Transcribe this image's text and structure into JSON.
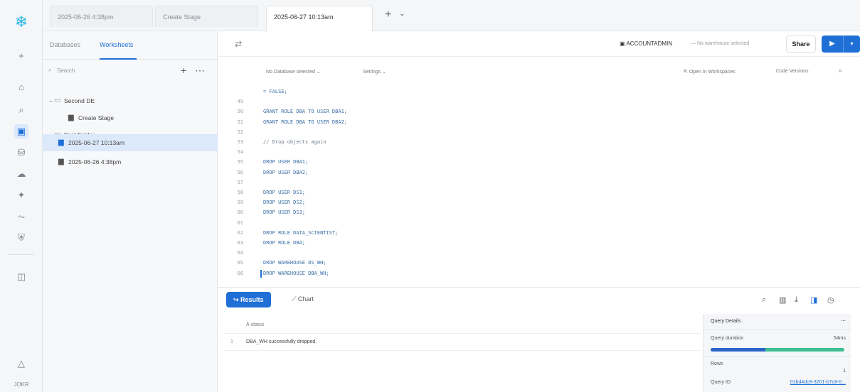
{
  "tabs": [
    "2025-06-26 4:38pm",
    "Create Stage",
    "2025-06-27 10:13am"
  ],
  "rail": {
    "user": "JOKR"
  },
  "panel": {
    "tabs": [
      "Databases",
      "Worksheets"
    ],
    "search_placeholder": "Search",
    "tree": [
      {
        "label": "Second DE",
        "type": "folder"
      },
      {
        "label": "Create Stage",
        "type": "worksheet"
      },
      {
        "label": "First Folder",
        "type": "folder"
      },
      {
        "label": "2025-06-27 10:13am",
        "type": "worksheet"
      },
      {
        "label": "2025-06-26 4:38pm",
        "type": "worksheet"
      }
    ]
  },
  "toolbar": {
    "role": "ACCOUNTADMIN",
    "warehouse": "No warehouse selected",
    "share": "Share"
  },
  "subbar": {
    "database": "No Database selected",
    "settings": "Settings",
    "open_in_workspaces": "Open in Workspaces",
    "code_versions": "Code Versions"
  },
  "code": [
    {
      "n": "",
      "t": "= FALSE;"
    },
    {
      "n": "49",
      "t": ""
    },
    {
      "n": "50",
      "t": "GRANT ROLE DBA TO USER DBA1;"
    },
    {
      "n": "51",
      "t": "GRANT ROLE DBA TO USER DBA2;"
    },
    {
      "n": "52",
      "t": ""
    },
    {
      "n": "53",
      "t": "// Drop objects again"
    },
    {
      "n": "54",
      "t": ""
    },
    {
      "n": "55",
      "t": "DROP USER DBA1;"
    },
    {
      "n": "56",
      "t": "DROP USER DBA2;"
    },
    {
      "n": "57",
      "t": ""
    },
    {
      "n": "58",
      "t": "DROP USER DS1;"
    },
    {
      "n": "59",
      "t": "DROP USER DS2;"
    },
    {
      "n": "60",
      "t": "DROP USER DS3;"
    },
    {
      "n": "61",
      "t": ""
    },
    {
      "n": "62",
      "t": "DROP ROLE DATA_SCIENTIST;"
    },
    {
      "n": "63",
      "t": "DROP ROLE DBA;"
    },
    {
      "n": "64",
      "t": ""
    },
    {
      "n": "65",
      "t": "DROP WAREHOUSE DS_WH;"
    },
    {
      "n": "66",
      "t": "DROP WAREHOUSE DBA_WH;"
    }
  ],
  "results": {
    "results_label": "Results",
    "chart_label": "Chart",
    "column": "status",
    "rows": [
      {
        "idx": "1",
        "status": "DBA_WH successfully dropped."
      }
    ]
  },
  "query_details": {
    "title": "Query Details",
    "duration_label": "Query duration",
    "duration": "54ms",
    "rows_label": "Rows",
    "rows": "1",
    "query_id_label": "Query ID",
    "query_id": "01bd4dc8-3201-b7c8-0..."
  }
}
